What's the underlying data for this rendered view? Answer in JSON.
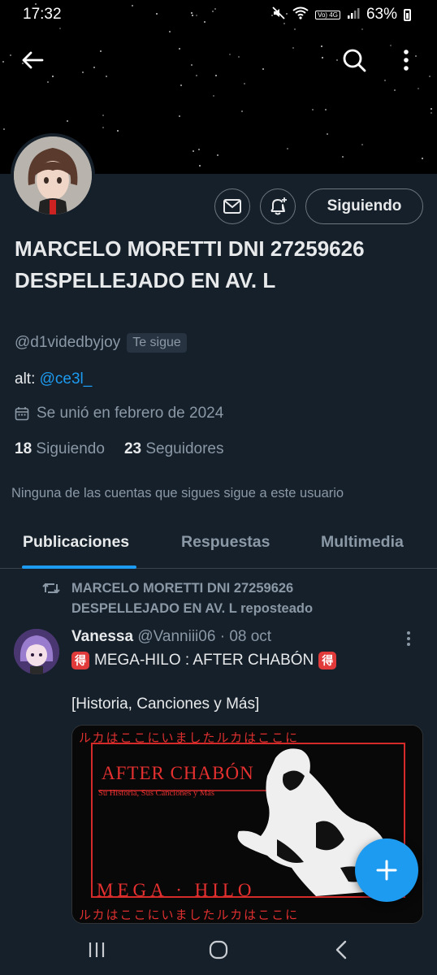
{
  "status_bar": {
    "time": "17:32",
    "network_badge": "Vo) 4G",
    "battery_percent": "63%"
  },
  "profile": {
    "display_name": "MARCELO MORETTI DNI 27259626 DESPELLEJADO EN AV. L",
    "handle": "@d1videdbyjoy",
    "follows_you_badge": "Te sigue",
    "bio_prefix": "alt: ",
    "bio_link": "@ce3l_",
    "joined": "Se unió en febrero de 2024",
    "following_count": "18",
    "following_label": "Siguiendo",
    "followers_count": "23",
    "followers_label": "Seguidores",
    "mutuals_note": "Ninguna de las cuentas que sigues sigue a este usuario",
    "follow_button_label": "Siguiendo"
  },
  "tabs": [
    {
      "label": "Publicaciones",
      "active": true
    },
    {
      "label": "Respuestas",
      "active": false
    },
    {
      "label": "Multimedia",
      "active": false
    }
  ],
  "post": {
    "repost_label": "MARCELO MORETTI DNI 27259626 DESPELLEJADO EN AV. L reposteado",
    "author": "Vanessa",
    "author_handle": "@Vanniii06",
    "separator": "·",
    "date": "08 oct",
    "emoji_glyph": "得",
    "line1": "MEGA-HILO : AFTER CHABÓN",
    "line2": "[Historia, Canciones y Más]",
    "image": {
      "title": "AFTER CHABÓN",
      "subtitle": "Su Historia, Sus Canciones y Más",
      "bottom_text": "MEGA · HILO",
      "border_text": "ルカはここにいましたルカはここに"
    }
  },
  "icons": {
    "back": "back-arrow-icon",
    "search": "search-icon",
    "more": "more-vertical-icon",
    "message": "mail-icon",
    "notify": "bell-plus-icon",
    "calendar": "calendar-icon",
    "repost": "repost-icon",
    "compose": "plus-icon"
  },
  "colors": {
    "background": "#15202b",
    "accent": "#1d9bf0",
    "secondary_text": "#8b98a5",
    "image_red": "#e53030"
  }
}
